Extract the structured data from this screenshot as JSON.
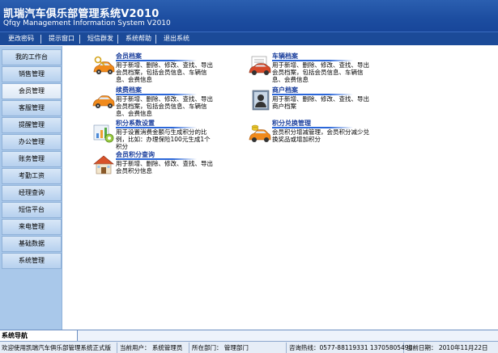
{
  "window": {
    "title": "凯瑞汽车俱乐部管理系统V2010",
    "subtitle": "Qfqy Management Information System V2010"
  },
  "menu": [
    "更改密码",
    "提示窗口",
    "短信群发",
    "系统帮助",
    "退出系统"
  ],
  "sidebar": {
    "items": [
      {
        "label": "我的工作台"
      },
      {
        "label": "销售管理"
      },
      {
        "label": "会员管理",
        "active": true
      },
      {
        "label": "客服管理"
      },
      {
        "label": "提醒管理"
      },
      {
        "label": "办公管理"
      },
      {
        "label": "账务管理"
      },
      {
        "label": "考勤工资"
      },
      {
        "label": "经理查询"
      },
      {
        "label": "短信平台"
      },
      {
        "label": "来电管理"
      },
      {
        "label": "基础数据"
      },
      {
        "label": "系统管理"
      }
    ]
  },
  "modules": [
    {
      "title": "会员档案",
      "desc": "用于新增、删除、修改、查找、导出会员档案，包括会员信息、车辆信息、会费信息",
      "icon": "car-key-icon"
    },
    {
      "title": "车辆档案",
      "desc": "用于新增、删除、修改、查找、导出会员档案，包括会员信息、车辆信息、会费信息",
      "icon": "car-document-icon"
    },
    {
      "title": "续费档案",
      "desc": "用于新增、删除、修改、查找、导出会员档案，包括会员信息、车辆信息、会费信息",
      "icon": "car-renew-icon"
    },
    {
      "title": "商户档案",
      "desc": "用于新增、删除、修改、查找、导出商户档案",
      "icon": "merchant-icon"
    },
    {
      "title": "积分系数设置",
      "desc": "用于设置消费金额与生成积分的比例，比如：办理保险100元生成1个积分",
      "icon": "chart-settings-icon"
    },
    {
      "title": "积分兑换管理",
      "desc": "会员积分增减管理，会员积分减少兑换奖品或增加积分",
      "icon": "car-coins-icon"
    },
    {
      "title": "会员积分查询",
      "desc": "用于新增、删除、修改、查找、导出会员积分信息",
      "icon": "house-icon"
    }
  ],
  "footer": {
    "nav_label": "系统导航",
    "welcome": "欢迎使用凯瑞汽车俱乐部管理系统正式版",
    "user": "当前用户：  系统管理员",
    "dept": "所在部门：  管理部门",
    "hotline": "咨询热线：0577-88119331  13705805498",
    "date": "当前日期：  2010年11月22日"
  },
  "colors": {
    "title_bg": "#1c4da0",
    "sidebar_bg": "#a9c8ea",
    "module_title": "#1a3e9c",
    "car_orange": "#f08a1c"
  }
}
